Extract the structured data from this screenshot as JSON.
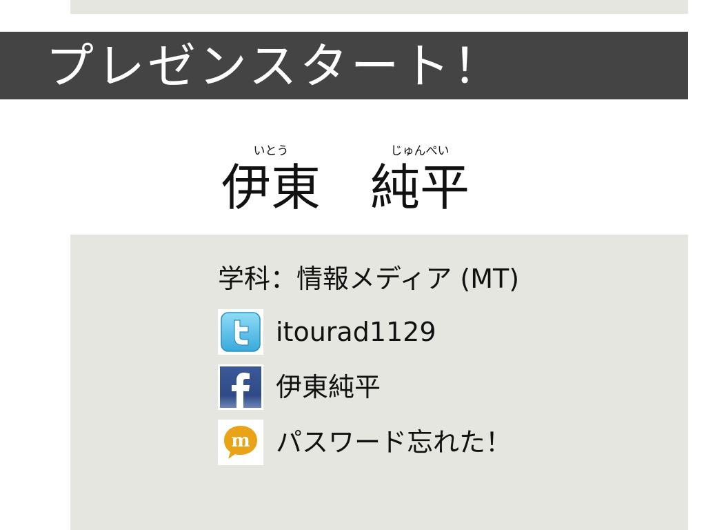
{
  "slide": {
    "title": "プレゼンスタート！"
  },
  "name": {
    "family_ruby": "いとう",
    "family": "伊東",
    "given_ruby": "じゅんぺい",
    "given": "純平"
  },
  "profile": {
    "department": "学科：情報メディア (MT)"
  },
  "contacts": [
    {
      "icon": "twitter-icon",
      "text": "itourad1129"
    },
    {
      "icon": "facebook-icon",
      "text": "伊東純平"
    },
    {
      "icon": "mixi-icon",
      "text": "パスワード忘れた！"
    }
  ],
  "colors": {
    "title_band": "#444444",
    "panel": "#e6e6e0",
    "text": "#111111",
    "title_text": "#ffffff",
    "twitter": "#5bc0e8",
    "facebook": "#3b5998",
    "mixi": "#e8a317"
  }
}
